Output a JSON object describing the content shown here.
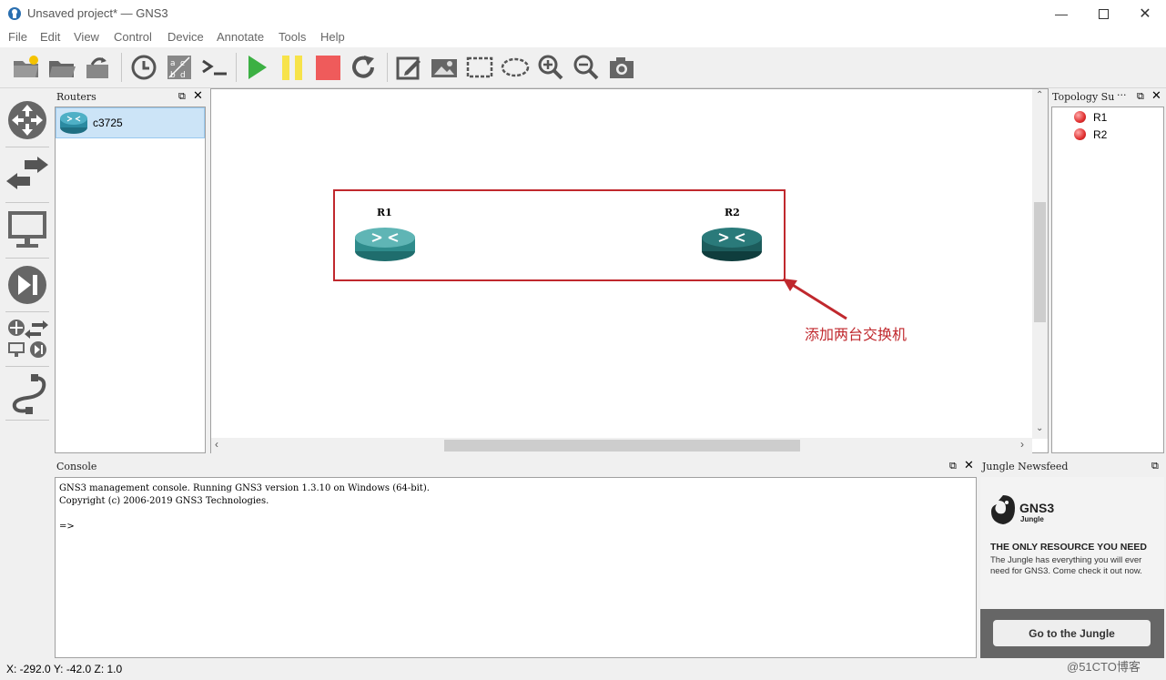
{
  "window": {
    "title": "Unsaved project* — GNS3"
  },
  "menu": [
    "File",
    "Edit",
    "View",
    "Control",
    "Device",
    "Annotate",
    "Tools",
    "Help"
  ],
  "routers_panel": {
    "title": "Routers",
    "items": [
      {
        "label": "c3725"
      }
    ]
  },
  "topology_panel": {
    "title": "Topology Su",
    "items": [
      {
        "label": "R1",
        "status_color": "#e03030"
      },
      {
        "label": "R2",
        "status_color": "#e03030"
      }
    ]
  },
  "canvas": {
    "nodes": [
      {
        "label": "R1",
        "color": "#2e8b8b"
      },
      {
        "label": "R2",
        "color": "#1c5c5c"
      }
    ],
    "annotation": "添加两台交换机",
    "highlight_color": "#c0282d"
  },
  "console": {
    "title": "Console",
    "lines": [
      "GNS3 management console. Running GNS3 version 1.3.10 on Windows (64-bit).",
      "Copyright (c) 2006-2019 GNS3 Technologies.",
      "",
      "=>"
    ]
  },
  "jungle": {
    "title": "Jungle Newsfeed",
    "logo_text": "GNS3",
    "logo_sub": "Jungle",
    "headline": "THE ONLY RESOURCE YOU NEED",
    "body": "The Jungle has everything you will ever need for GNS3. Come check it out now.",
    "button": "Go to the Jungle"
  },
  "status": {
    "coords": "X: -292.0 Y: -42.0 Z: 1.0"
  },
  "watermark": "@51CTO博客",
  "icons": {
    "toolbar": [
      "new-project-icon",
      "open-project-icon",
      "save-project-icon",
      "snapshot-clock-icon",
      "show-interface-labels-icon",
      "console-all-icon",
      "start-all-icon",
      "suspend-all-icon",
      "stop-all-icon",
      "reload-all-icon",
      "add-note-icon",
      "insert-picture-icon",
      "draw-rectangle-icon",
      "draw-ellipse-icon",
      "zoom-in-icon",
      "zoom-out-icon",
      "screenshot-icon"
    ]
  }
}
